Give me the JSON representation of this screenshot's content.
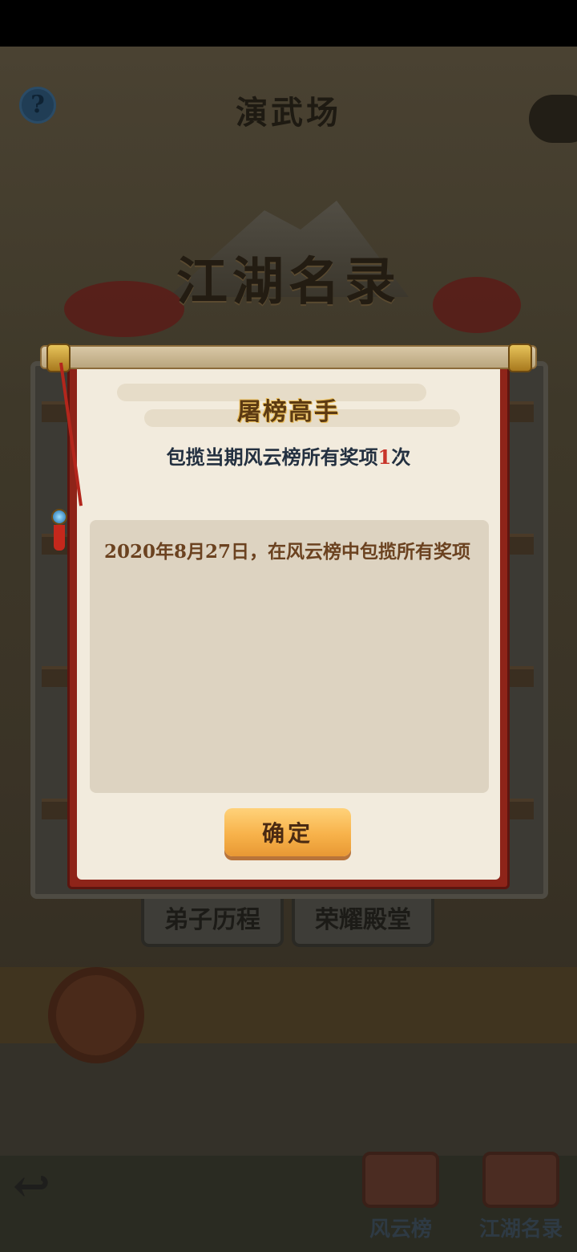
{
  "scene": {
    "title": "演武场",
    "help_label": "?",
    "board_title": "江湖名录",
    "tabs": [
      "弟子历程",
      "荣耀殿堂"
    ],
    "back_label": "↩",
    "nav": {
      "ranking_label": "风云榜",
      "roster_label": "江湖名录"
    }
  },
  "modal": {
    "title": "屠榜高手",
    "subtitle_prefix": "包揽当期风云榜所有奖项",
    "subtitle_count": "1",
    "subtitle_suffix": "次",
    "record_text": "2020年8月27日，在风云榜中包揽所有奖项",
    "confirm_label": "确定"
  },
  "colors": {
    "modal_border": "#8e2419",
    "paper": "#f2ebdd",
    "button": "#f7b24a",
    "highlight": "#c8342a"
  }
}
